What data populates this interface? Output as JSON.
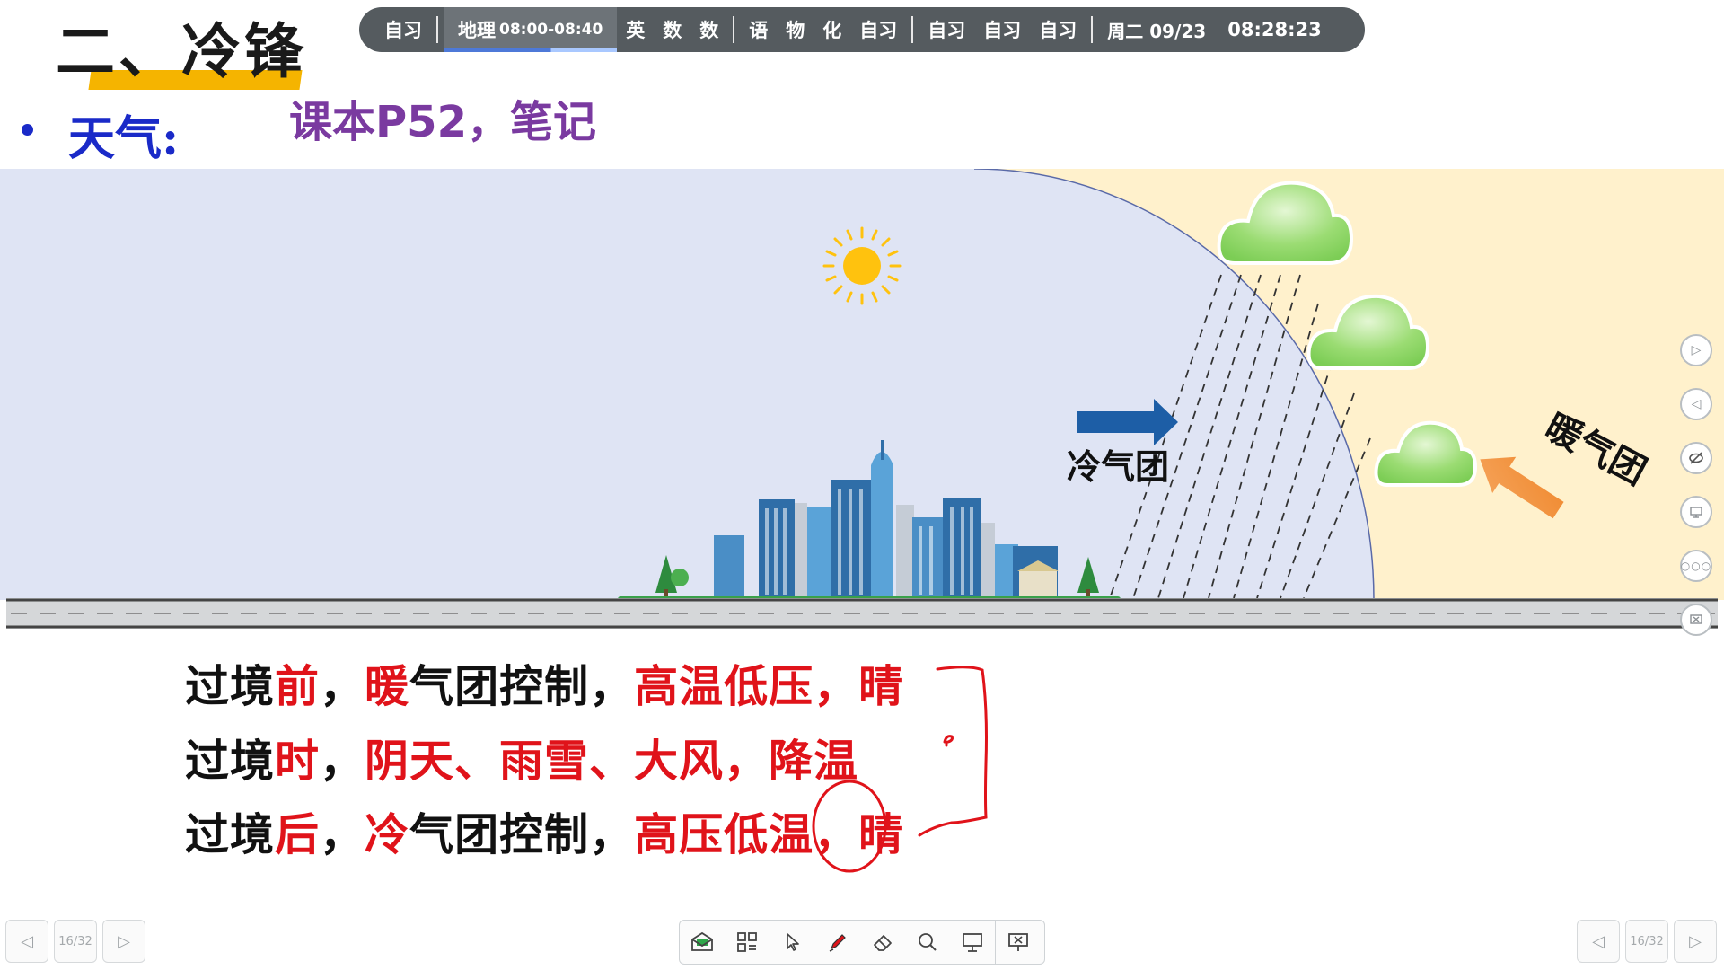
{
  "slide": {
    "title": "二、冷锋",
    "bullet_label": "天气:",
    "note": "课本P52，笔记"
  },
  "schedule": {
    "items_a": [
      "自习"
    ],
    "active": {
      "subject": "地理",
      "time": "08:00-08:40"
    },
    "items_b": [
      "英",
      "数",
      "数"
    ],
    "items_c": [
      "语",
      "物",
      "化",
      "自习"
    ],
    "items_d": [
      "自习",
      "自习",
      "自习"
    ],
    "date": "周二 09/23",
    "clock": "08:28:23"
  },
  "diagram": {
    "cold_air_label": "冷气团",
    "warm_air_label": "暖气团",
    "colors": {
      "cold_bg": "#dfe4f4",
      "warm_bg": "#fff1cc",
      "cloud": "#8fd66a",
      "sun": "#ffc20e",
      "cold_arrow": "#1d5ea6",
      "warm_arrow": "#ef8a33"
    }
  },
  "sentences": [
    {
      "p1": "过境",
      "p2": "前",
      "p3": "，",
      "p4": "暖",
      "p5": "气团控制，",
      "p6": "高温低压，晴"
    },
    {
      "p1": "过境",
      "p2": "时",
      "p3": "，",
      "p4": "阴天、雨雪、大风，降温"
    },
    {
      "p1": "过境",
      "p2": "后",
      "p3": "，",
      "p4": "冷",
      "p5": "气团控制，",
      "p6": "高压低温，晴"
    }
  ],
  "navigation": {
    "page_left": "16/32",
    "page_right": "16/32"
  },
  "toolbar": {
    "tools": [
      "message-icon",
      "apps-grid-icon",
      "cursor-icon",
      "pen-icon",
      "eraser-icon",
      "zoom-icon",
      "whiteboard-icon",
      "exit-presentation-icon"
    ]
  }
}
